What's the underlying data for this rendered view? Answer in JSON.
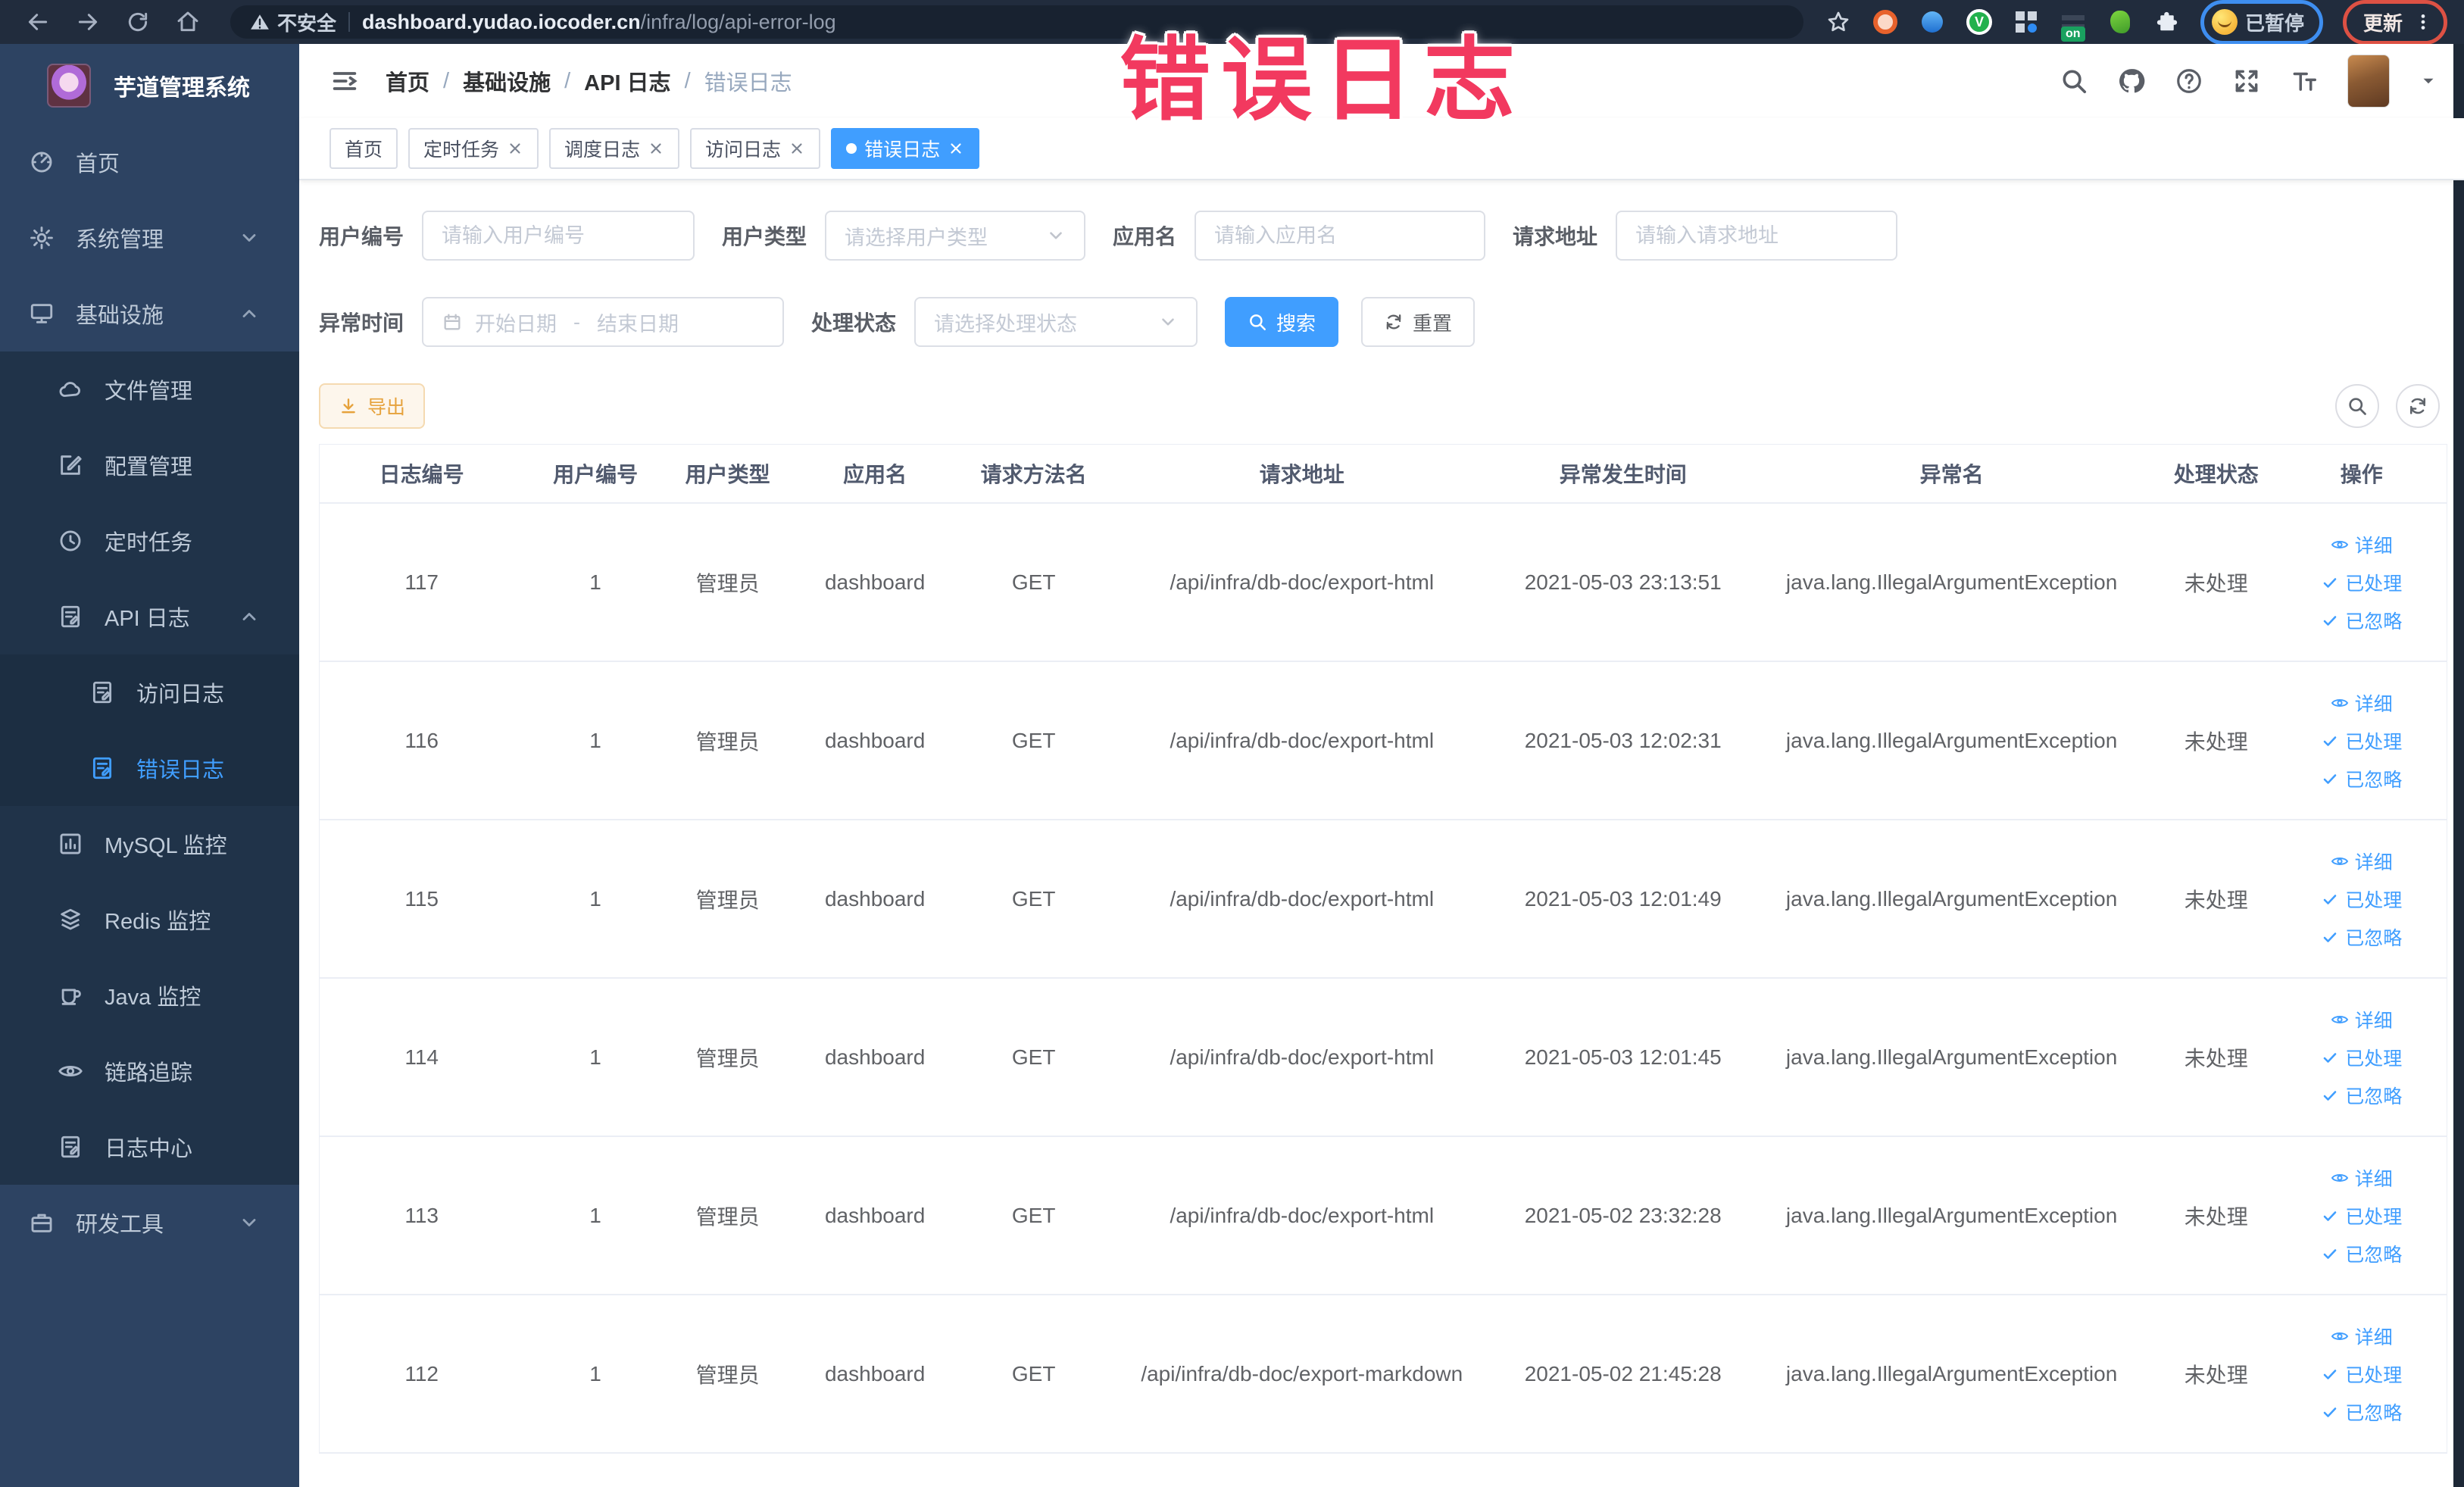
{
  "browser": {
    "security_label": "不安全",
    "url_domain": "dashboard.yudao.iocoder.cn",
    "url_path": "/infra/log/api-error-log",
    "extension_on_badge": "on",
    "paused_label": "已暂停",
    "update_label": "更新"
  },
  "annotation": {
    "text": "错误日志",
    "color": "#f2395f"
  },
  "sidebar": {
    "title": "芋道管理系统",
    "menu": [
      {
        "key": "home",
        "label": "首页",
        "icon": "gauge",
        "level": 0
      },
      {
        "key": "system",
        "label": "系统管理",
        "icon": "gear",
        "level": 0,
        "chevron": "down"
      },
      {
        "key": "infra",
        "label": "基础设施",
        "icon": "monitor",
        "level": 0,
        "chevron": "up"
      },
      {
        "key": "file",
        "label": "文件管理",
        "icon": "cloud",
        "level": 1
      },
      {
        "key": "config",
        "label": "配置管理",
        "icon": "edit",
        "level": 1
      },
      {
        "key": "job",
        "label": "定时任务",
        "icon": "clock",
        "level": 1
      },
      {
        "key": "api-log",
        "label": "API 日志",
        "icon": "log",
        "level": 1,
        "chevron": "up"
      },
      {
        "key": "access-log",
        "label": "访问日志",
        "icon": "log",
        "level": 2
      },
      {
        "key": "error-log",
        "label": "错误日志",
        "icon": "log",
        "level": 2,
        "active": true
      },
      {
        "key": "mysql",
        "label": "MySQL 监控",
        "icon": "chart",
        "level": 1
      },
      {
        "key": "redis",
        "label": "Redis 监控",
        "icon": "layers",
        "level": 1
      },
      {
        "key": "java",
        "label": "Java 监控",
        "icon": "cup",
        "level": 1
      },
      {
        "key": "trace",
        "label": "链路追踪",
        "icon": "eye",
        "level": 1
      },
      {
        "key": "log-center",
        "label": "日志中心",
        "icon": "log",
        "level": 1
      },
      {
        "key": "dev-tool",
        "label": "研发工具",
        "icon": "case",
        "level": 0,
        "chevron": "down"
      }
    ]
  },
  "header": {
    "breadcrumb": [
      "首页",
      "基础设施",
      "API 日志",
      "错误日志"
    ],
    "separator": "/"
  },
  "tabs": [
    {
      "label": "首页",
      "closable": false,
      "active": false
    },
    {
      "label": "定时任务",
      "closable": true,
      "active": false
    },
    {
      "label": "调度日志",
      "closable": true,
      "active": false
    },
    {
      "label": "访问日志",
      "closable": true,
      "active": false
    },
    {
      "label": "错误日志",
      "closable": true,
      "active": true
    }
  ],
  "filters": {
    "user_id_label": "用户编号",
    "user_id_placeholder": "请输入用户编号",
    "user_type_label": "用户类型",
    "user_type_placeholder": "请选择用户类型",
    "app_name_label": "应用名",
    "app_name_placeholder": "请输入应用名",
    "request_url_label": "请求地址",
    "request_url_placeholder": "请输入请求地址",
    "exception_time_label": "异常时间",
    "start_date_placeholder": "开始日期",
    "range_separator": "-",
    "end_date_placeholder": "结束日期",
    "process_status_label": "处理状态",
    "process_status_placeholder": "请选择处理状态",
    "search_label": "搜索",
    "reset_label": "重置"
  },
  "toolbar": {
    "export_label": "导出"
  },
  "table": {
    "columns": [
      "日志编号",
      "用户编号",
      "用户类型",
      "应用名",
      "请求方法名",
      "请求地址",
      "异常发生时间",
      "异常名",
      "处理状态",
      "操作"
    ],
    "row_actions": [
      {
        "label": "详细",
        "icon": "eye"
      },
      {
        "label": "已处理",
        "icon": "check"
      },
      {
        "label": "已忽略",
        "icon": "check"
      }
    ],
    "rows": [
      {
        "id": "117",
        "user_id": "1",
        "user_type": "管理员",
        "app": "dashboard",
        "method": "GET",
        "url": "/api/infra/db-doc/export-html",
        "time": "2021-05-03 23:13:51",
        "exception": "java.lang.IllegalArgumentException",
        "status": "未处理"
      },
      {
        "id": "116",
        "user_id": "1",
        "user_type": "管理员",
        "app": "dashboard",
        "method": "GET",
        "url": "/api/infra/db-doc/export-html",
        "time": "2021-05-03 12:02:31",
        "exception": "java.lang.IllegalArgumentException",
        "status": "未处理"
      },
      {
        "id": "115",
        "user_id": "1",
        "user_type": "管理员",
        "app": "dashboard",
        "method": "GET",
        "url": "/api/infra/db-doc/export-html",
        "time": "2021-05-03 12:01:49",
        "exception": "java.lang.IllegalArgumentException",
        "status": "未处理"
      },
      {
        "id": "114",
        "user_id": "1",
        "user_type": "管理员",
        "app": "dashboard",
        "method": "GET",
        "url": "/api/infra/db-doc/export-html",
        "time": "2021-05-03 12:01:45",
        "exception": "java.lang.IllegalArgumentException",
        "status": "未处理"
      },
      {
        "id": "113",
        "user_id": "1",
        "user_type": "管理员",
        "app": "dashboard",
        "method": "GET",
        "url": "/api/infra/db-doc/export-html",
        "time": "2021-05-02 23:32:28",
        "exception": "java.lang.IllegalArgumentException",
        "status": "未处理"
      },
      {
        "id": "112",
        "user_id": "1",
        "user_type": "管理员",
        "app": "dashboard",
        "method": "GET",
        "url": "/api/infra/db-doc/export-markdown",
        "time": "2021-05-02 21:45:28",
        "exception": "java.lang.IllegalArgumentException",
        "status": "未处理"
      }
    ]
  }
}
